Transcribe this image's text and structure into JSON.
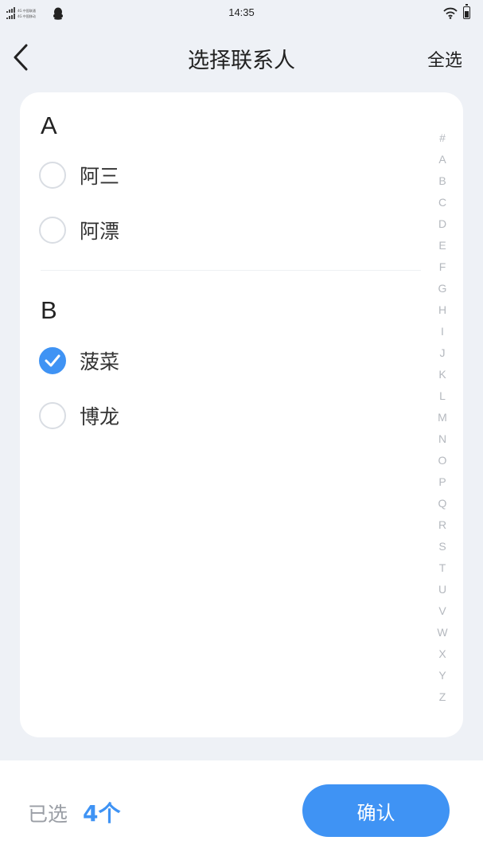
{
  "status_bar": {
    "time": "14:35",
    "carrier_1": "4G 中国联通",
    "carrier_2": "4G 中国移动",
    "icons": [
      "signal-icon",
      "qq-icon",
      "wifi-icon",
      "battery-icon"
    ]
  },
  "nav": {
    "back_icon": "chevron-left-icon",
    "title": "选择联系人",
    "select_all": "全选"
  },
  "contacts": {
    "sections": [
      {
        "letter": "A",
        "items": [
          {
            "name": "阿三",
            "checked": false
          },
          {
            "name": "阿漂",
            "checked": false
          }
        ]
      },
      {
        "letter": "B",
        "items": [
          {
            "name": "菠菜",
            "checked": true
          },
          {
            "name": "博龙",
            "checked": false
          }
        ]
      }
    ]
  },
  "index_bar": [
    "#",
    "A",
    "B",
    "C",
    "D",
    "E",
    "F",
    "G",
    "H",
    "I",
    "J",
    "K",
    "L",
    "M",
    "N",
    "O",
    "P",
    "Q",
    "R",
    "S",
    "T",
    "U",
    "V",
    "W",
    "X",
    "Y",
    "Z"
  ],
  "footer": {
    "selected_label": "已选",
    "selected_count": "4个",
    "confirm_label": "确认"
  },
  "colors": {
    "accent": "#3f93f4",
    "background": "#eef1f6",
    "card": "#ffffff",
    "index_text": "#b4b8be"
  }
}
